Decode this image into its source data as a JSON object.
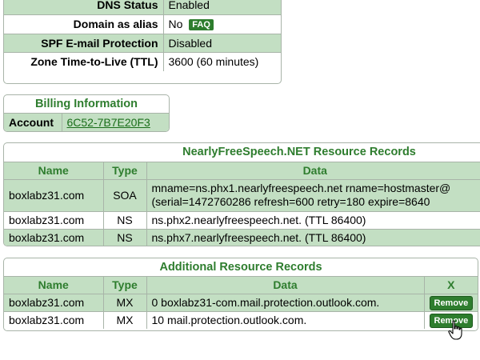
{
  "domain_settings": {
    "rows": [
      {
        "label": "DNS Status",
        "value": "Enabled"
      },
      {
        "label": "Domain as alias",
        "value": "No",
        "badge": "FAQ"
      },
      {
        "label": "SPF E-mail Protection",
        "value": "Disabled"
      },
      {
        "label": "Zone Time-to-Live (TTL)",
        "value": "3600 (60 minutes)"
      }
    ]
  },
  "billing": {
    "title": "Billing Information",
    "account_label": "Account",
    "account_value": "6C52-7B7E20F3"
  },
  "resource_records": {
    "title": "NearlyFreeSpeech.NET Resource Records",
    "columns": [
      "Name",
      "Type",
      "Data"
    ],
    "rows": [
      {
        "name": "boxlabz31.com",
        "type": "SOA",
        "data_line1": "mname=ns.phx1.nearlyfreespeech.net rname=hostmaster@",
        "data_line2": "(serial=1472760286 refresh=600 retry=180 expire=8640"
      },
      {
        "name": "boxlabz31.com",
        "type": "NS",
        "data": "ns.phx2.nearlyfreespeech.net. (TTL 86400)"
      },
      {
        "name": "boxlabz31.com",
        "type": "NS",
        "data": "ns.phx7.nearlyfreespeech.net. (TTL 86400)"
      }
    ]
  },
  "additional_records": {
    "title": "Additional Resource Records",
    "columns": [
      "Name",
      "Type",
      "Data",
      "X"
    ],
    "rows": [
      {
        "name": "boxlabz31.com",
        "type": "MX",
        "data": "0 boxlabz31-com.mail.protection.outlook.com.",
        "action": "Remove"
      },
      {
        "name": "boxlabz31.com",
        "type": "MX",
        "data": "10 mail.protection.outlook.com.",
        "action": "Remove"
      }
    ]
  },
  "colors": {
    "row_green": "#c3dfc3",
    "accent_green": "#2e7d2e",
    "border": "#a8b4a8"
  }
}
